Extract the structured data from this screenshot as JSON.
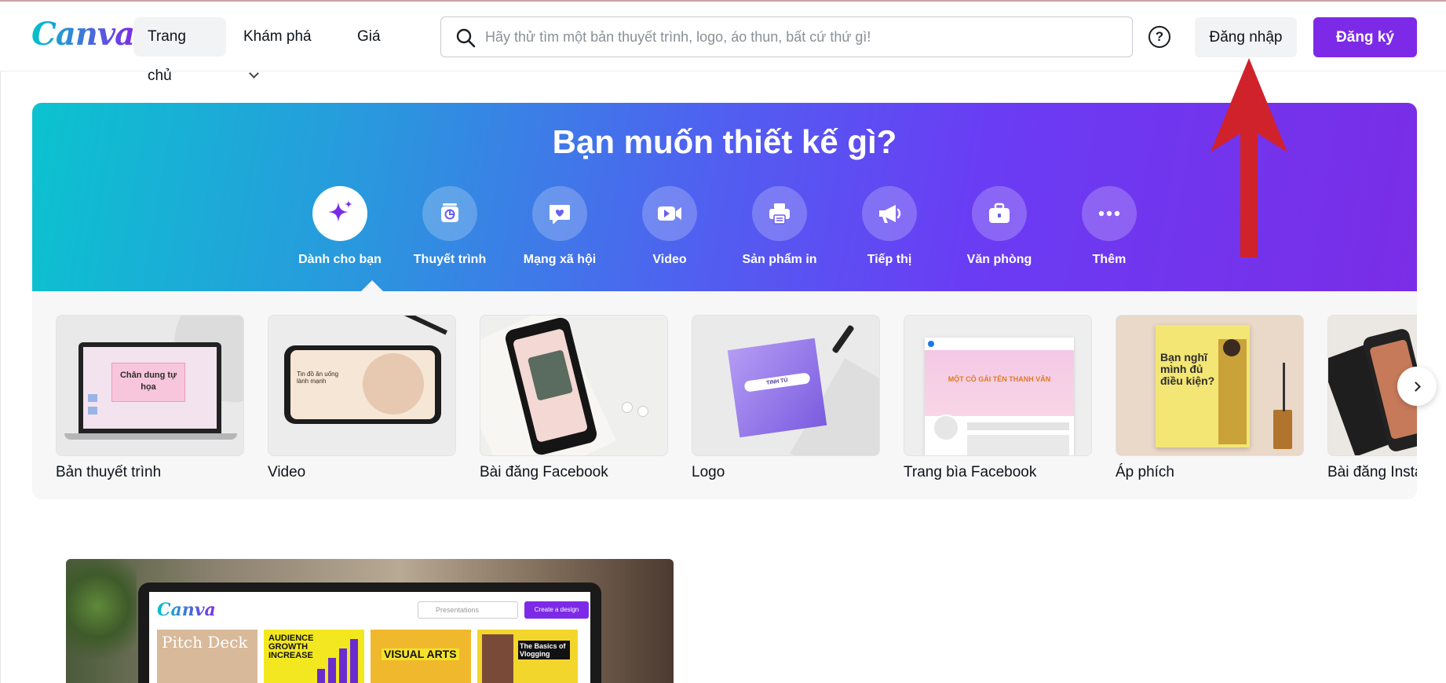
{
  "header": {
    "logo": "Canva",
    "nav": {
      "home": "Trang chủ",
      "explore": "Khám phá",
      "price": "Giá"
    },
    "search_placeholder": "Hãy thử tìm một bản thuyết trình, logo, áo thun, bất cứ thứ gì!",
    "help": "?",
    "login": "Đăng nhập",
    "signup": "Đăng ký"
  },
  "hero": {
    "title": "Bạn muốn thiết kế gì?",
    "categories": [
      {
        "label": "Dành cho bạn",
        "icon": "sparkle-icon",
        "active": true
      },
      {
        "label": "Thuyết trình",
        "icon": "presentation-icon"
      },
      {
        "label": "Mạng xã hội",
        "icon": "heart-chat-icon"
      },
      {
        "label": "Video",
        "icon": "video-camera-icon"
      },
      {
        "label": "Sản phẩm in",
        "icon": "printer-icon"
      },
      {
        "label": "Tiếp thị",
        "icon": "megaphone-icon"
      },
      {
        "label": "Văn phòng",
        "icon": "briefcase-icon"
      },
      {
        "label": "Thêm",
        "icon": "more-icon"
      }
    ]
  },
  "templates": [
    {
      "label": "Bản thuyết trình",
      "thumb_text": "Chân dung tự họa"
    },
    {
      "label": "Video",
      "thumb_text": "Tin đồ ăn uống lành mạnh"
    },
    {
      "label": "Bài đăng Facebook",
      "thumb_text": ""
    },
    {
      "label": "Logo",
      "thumb_text": "TINH TÚ"
    },
    {
      "label": "Trang bìa Facebook",
      "thumb_text": "MỘT CÔ GÁI TÊN THANH VÂN"
    },
    {
      "label": "Áp phích",
      "thumb_text": "Bạn nghĩ mình đủ điều kiện?"
    },
    {
      "label": "Bài đăng Insta",
      "thumb_text": ""
    }
  ],
  "promo": {
    "logo": "Canva",
    "search_placeholder": "Presentations",
    "button": "Create a design",
    "cards": [
      "Pitch Deck",
      "AUDIENCE GROWTH INCREASE",
      "VISUAL ARTS",
      "The Basics of Vlogging"
    ]
  },
  "colors": {
    "brand_purple": "#7d2ae8",
    "brand_teal": "#00c4cc",
    "annotation_red": "#d0222a"
  }
}
